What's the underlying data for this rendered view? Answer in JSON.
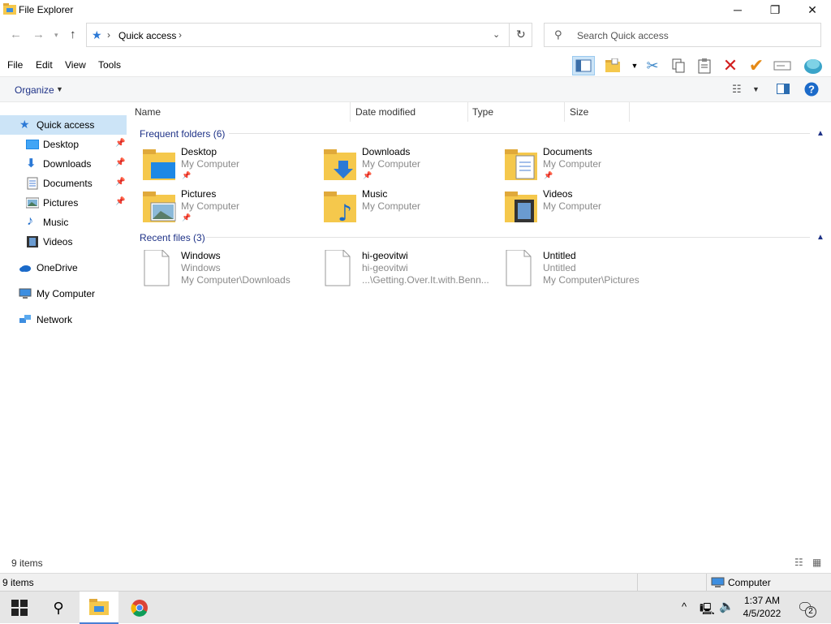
{
  "window": {
    "title": "File Explorer"
  },
  "address": {
    "crumb": "Quick access",
    "search_placeholder": "Search Quick access"
  },
  "menu": [
    "File",
    "Edit",
    "View",
    "Tools"
  ],
  "command": {
    "organize": "Organize"
  },
  "sidebar": {
    "quick_access": "Quick access",
    "items": [
      {
        "label": "Desktop",
        "pinned": true
      },
      {
        "label": "Downloads",
        "pinned": true
      },
      {
        "label": "Documents",
        "pinned": true
      },
      {
        "label": "Pictures",
        "pinned": true
      },
      {
        "label": "Music",
        "pinned": false
      },
      {
        "label": "Videos",
        "pinned": false
      }
    ],
    "onedrive": "OneDrive",
    "computer": "My Computer",
    "network": "Network"
  },
  "columns": {
    "name": "Name",
    "date": "Date modified",
    "type": "Type",
    "size": "Size"
  },
  "frequent": {
    "header": "Frequent folders (6)",
    "items": [
      {
        "name": "Desktop",
        "location": "My Computer"
      },
      {
        "name": "Downloads",
        "location": "My Computer"
      },
      {
        "name": "Documents",
        "location": "My Computer"
      },
      {
        "name": "Pictures",
        "location": "My Computer"
      },
      {
        "name": "Music",
        "location": "My Computer"
      },
      {
        "name": "Videos",
        "location": "My Computer"
      }
    ]
  },
  "recent": {
    "header": "Recent files (3)",
    "items": [
      {
        "name": "Windows",
        "sub": "Windows",
        "path": "My Computer\\Downloads"
      },
      {
        "name": "hi-geovitwi",
        "sub": "hi-geovitwi",
        "path": "...\\Getting.Over.It.with.Benn..."
      },
      {
        "name": "Untitled",
        "sub": "Untitled",
        "path": "My Computer\\Pictures"
      }
    ]
  },
  "status": {
    "items": "9 items",
    "items2": "9 items",
    "zone": "Computer"
  },
  "taskbar": {
    "time": "1:37 AM",
    "date": "4/5/2022",
    "notifications": "2"
  },
  "colors": {
    "accent": "#1e3287",
    "selection": "#cce4f7",
    "folder": "#f5c84c"
  }
}
